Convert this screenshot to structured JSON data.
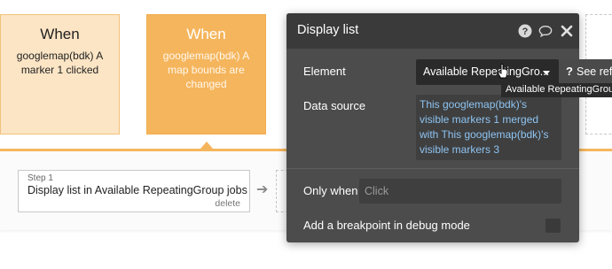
{
  "workflow": {
    "events": [
      {
        "when": "When",
        "text": "googlemap(bdk) A marker 1 clicked"
      },
      {
        "when": "When",
        "text": "googlemap(bdk) A map bounds are changed"
      }
    ],
    "step": {
      "label": "Step 1",
      "title": "Display list in Available RepeatingGroup jobs",
      "delete": "delete"
    }
  },
  "panel": {
    "title": "Display list",
    "icons": {
      "help": "help-circle-icon",
      "comment": "speech-bubble-icon",
      "close": "close-icon"
    },
    "element": {
      "label": "Element",
      "value": "Available RepeatingGro...",
      "tooltip": "Available RepeatingGroup"
    },
    "see_ref": {
      "q": "?",
      "label": "See ref"
    },
    "data_source": {
      "label": "Data source",
      "value": "This googlemap(bdk)'s visible markers 1 merged with This googlemap(bdk)'s visible markers 3"
    },
    "only_when": {
      "label": "Only when",
      "placeholder": "Click"
    },
    "breakpoint": {
      "label": "Add a breakpoint in debug mode",
      "checked": false
    }
  },
  "colors": {
    "event_light": "#fce5c5",
    "event_active": "#f5b55c",
    "panel_bg": "#4c4c4c",
    "panel_header": "#3a3a3a",
    "link_blue": "#8ec4f2"
  }
}
